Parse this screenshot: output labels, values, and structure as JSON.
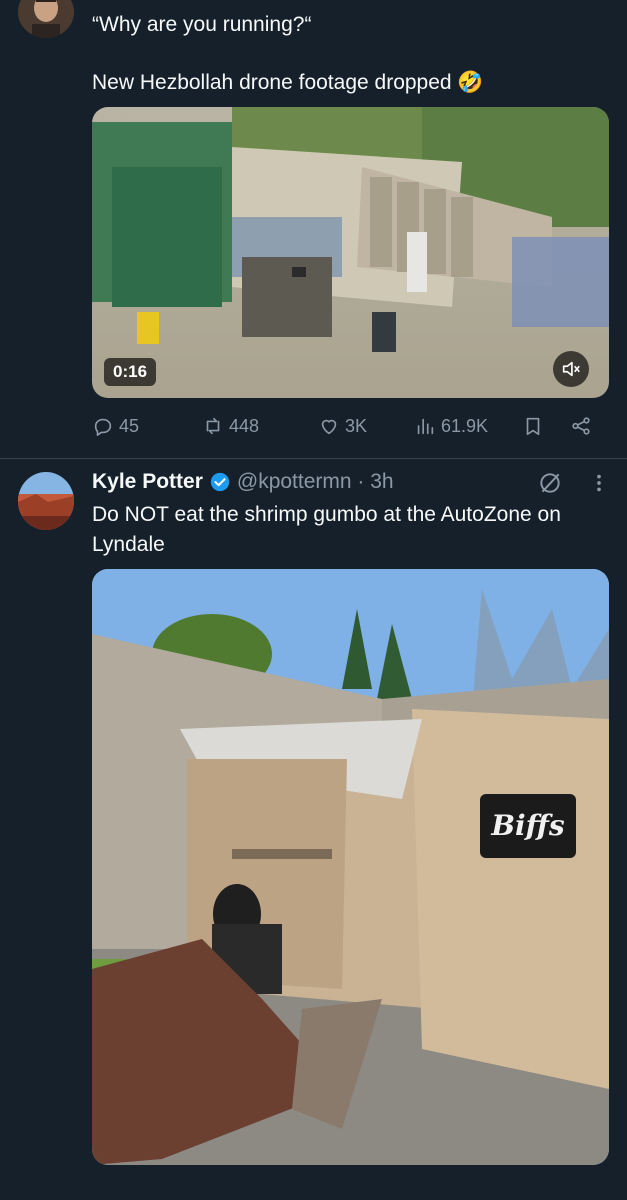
{
  "tweet1": {
    "quote_text": "“Why are you running?“",
    "body_text": "New Hezbollah drone footage dropped 🤣",
    "video_duration": "0:16",
    "actions": {
      "replies": "45",
      "reposts": "448",
      "likes": "3K",
      "views": "61.9K"
    }
  },
  "tweet2": {
    "author_name": "Kyle Potter",
    "author_handle": "@kpottermn · 3h",
    "body_text": "Do NOT eat the shrimp gumbo at the AutoZone on Lyndale",
    "image_text": "Biffs"
  },
  "colors": {
    "background": "#15202b",
    "text": "#f7f9f9",
    "muted": "#8b98a5",
    "verified": "#1d9bf0",
    "divider": "#38444d"
  }
}
